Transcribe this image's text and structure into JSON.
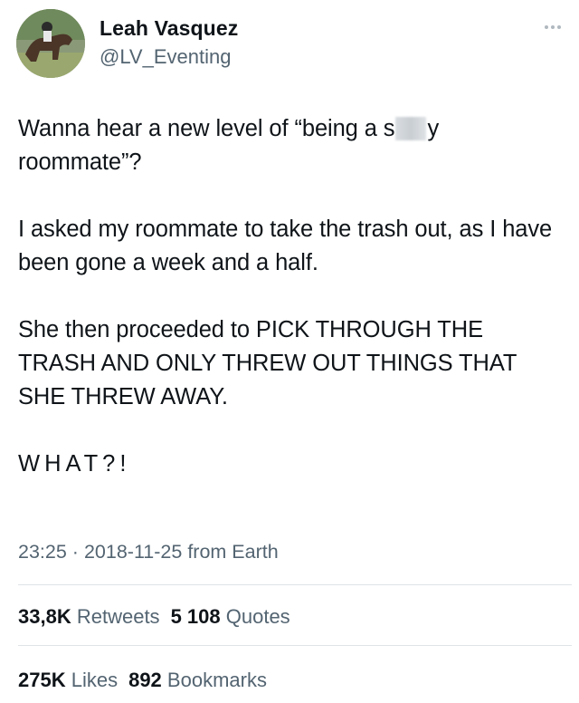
{
  "author": {
    "name": "Leah Vasquez",
    "handle": "@LV_Eventing"
  },
  "icons": {
    "avatar": "horse-rider-photo",
    "more": "more-dots-icon"
  },
  "tweet": {
    "line1_pre": "Wanna hear a new level of “being a s",
    "line1_post": "y",
    "line2": "roommate”?",
    "para2": "I asked my roommate to take the trash out, as I have been gone a week and a half.",
    "para3": "She then proceeded to PICK THROUGH THE TRASH AND ONLY THREW OUT THINGS THAT SHE THREW AWAY.",
    "para4": "WHAT?!"
  },
  "meta": {
    "time": "23:25",
    "separator": "·",
    "date": "2018-11-25",
    "source": "from Earth"
  },
  "stats": {
    "retweets_count": "33,8K",
    "retweets_label": "Retweets",
    "quotes_count": "5 108",
    "quotes_label": "Quotes",
    "likes_count": "275K",
    "likes_label": "Likes",
    "bookmarks_count": "892",
    "bookmarks_label": "Bookmarks"
  }
}
